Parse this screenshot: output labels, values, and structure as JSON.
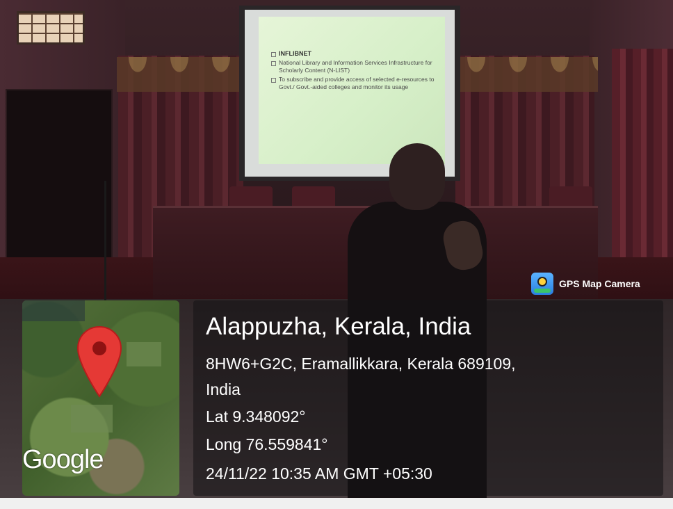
{
  "slide": {
    "heading": "INFLIBNET",
    "bullets": [
      "National Library and Information Services Infrastructure for Scholarly Content (N-LIST)",
      "To subscribe and provide access of selected e-resources to Govt./ Govt.-aided colleges and monitor its usage"
    ]
  },
  "badge": {
    "icon": "gps-map-camera-app-icon",
    "label": "GPS Map Camera"
  },
  "map": {
    "logo": "Google",
    "pin_color": "#e53935"
  },
  "location": {
    "title": "Alappuzha, Kerala, India",
    "address_line1": "8HW6+G2C, Eramallikkara, Kerala 689109,",
    "address_line2": "India",
    "lat": "Lat 9.348092°",
    "long": "Long 76.559841°",
    "datetime": "24/11/22 10:35 AM GMT +05:30"
  }
}
